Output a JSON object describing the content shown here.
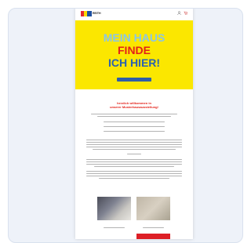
{
  "site": {
    "logo_text": "REITH",
    "header_icons": [
      "user-icon",
      "cart-icon"
    ]
  },
  "hero": {
    "line1": "MEIN HAUS",
    "line2": "FINDE",
    "line3": "ICH HIER!",
    "button_label": "",
    "colors": {
      "background": "#fbe700",
      "line1": "#8ac6e8",
      "line2": "#e32119",
      "line3": "#2a62b0",
      "button": "#2f5ea8"
    }
  },
  "welcome": {
    "heading_line1": "herzlich willkommen in",
    "heading_line2": "unserer Musterhausausstellung!"
  },
  "cards": [
    {
      "label": ""
    },
    {
      "label": ""
    }
  ],
  "promo_badge": ""
}
